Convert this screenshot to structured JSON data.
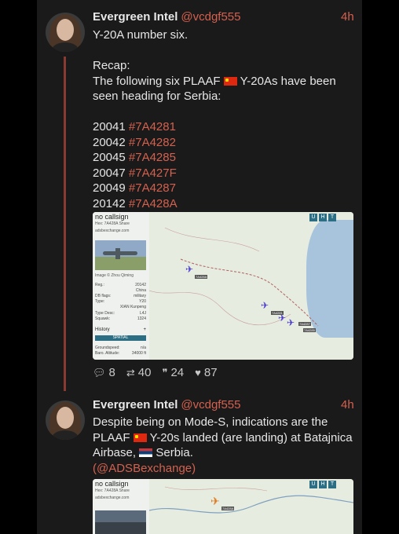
{
  "tweet1": {
    "author_name": "Evergreen Intel",
    "author_handle": "@vcdgf555",
    "time": "4h",
    "line1": "Y-20A number six.",
    "line2": "Recap:",
    "line3_part1": "The following six PLAAF ",
    "line3_part2": " Y-20As have been",
    "line4": "seen heading for Serbia:",
    "aircraft": [
      {
        "num": "20041",
        "hex": "#7A4281"
      },
      {
        "num": "20042",
        "hex": "#7A4282"
      },
      {
        "num": "20045",
        "hex": "#7A4285"
      },
      {
        "num": "20047",
        "hex": "#7A427F"
      },
      {
        "num": "20049",
        "hex": "#7A4287"
      },
      {
        "num": "20142",
        "hex": "#7A428A"
      }
    ],
    "media": {
      "callsign": "no callsign",
      "hex_label": "Hex: 7A428A Share",
      "site": "adsbexchange.com",
      "rows": [
        {
          "k": "Reg.:",
          "v": "20142"
        },
        {
          "k": "",
          "v": "China"
        },
        {
          "k": "DB flags:",
          "v": "military"
        },
        {
          "k": "Type:",
          "v": "Y20"
        },
        {
          "k": "",
          "v": "XIAN Kunpeng"
        },
        {
          "k": "Type Desc:",
          "v": "L4J"
        },
        {
          "k": "Squawk:",
          "v": "1324"
        }
      ],
      "history": "History",
      "spinal": "SPATIAL",
      "rows2": [
        {
          "k": "Groundspeed:",
          "v": "n/a"
        },
        {
          "k": "Baro. Altitude:",
          "v": "34000 ft"
        }
      ],
      "photo_credit": "Image © Zhou Qiming",
      "controls": [
        "U",
        "H",
        "T"
      ],
      "tags": [
        "7A428A",
        "7A4281",
        "7A4287",
        "7A4285"
      ]
    },
    "stats": {
      "replies": "8",
      "retweets": "40",
      "quotes": "24",
      "likes": "87"
    }
  },
  "tweet2": {
    "author_name": "Evergreen Intel",
    "author_handle": "@vcdgf555",
    "time": "4h",
    "line1": "Despite being on Mode-S, indications are the",
    "line2_part1": "PLAAF ",
    "line2_part2": " Y-20s landed (are landing) at Batajnica",
    "line3_part1": "Airbase, ",
    "line3_part2": " Serbia.",
    "line4_mention": "(@ADSBexchange)",
    "media": {
      "callsign": "no callsign",
      "hex_label": "Hex: 7A428A Share",
      "site": "adsbexchange.com",
      "controls": [
        "U",
        "H",
        "T"
      ],
      "tag": "7A428A"
    }
  },
  "colors": {
    "accent": "#d4614f",
    "thread": "#8a3a30",
    "background": "#1a1a1a"
  }
}
